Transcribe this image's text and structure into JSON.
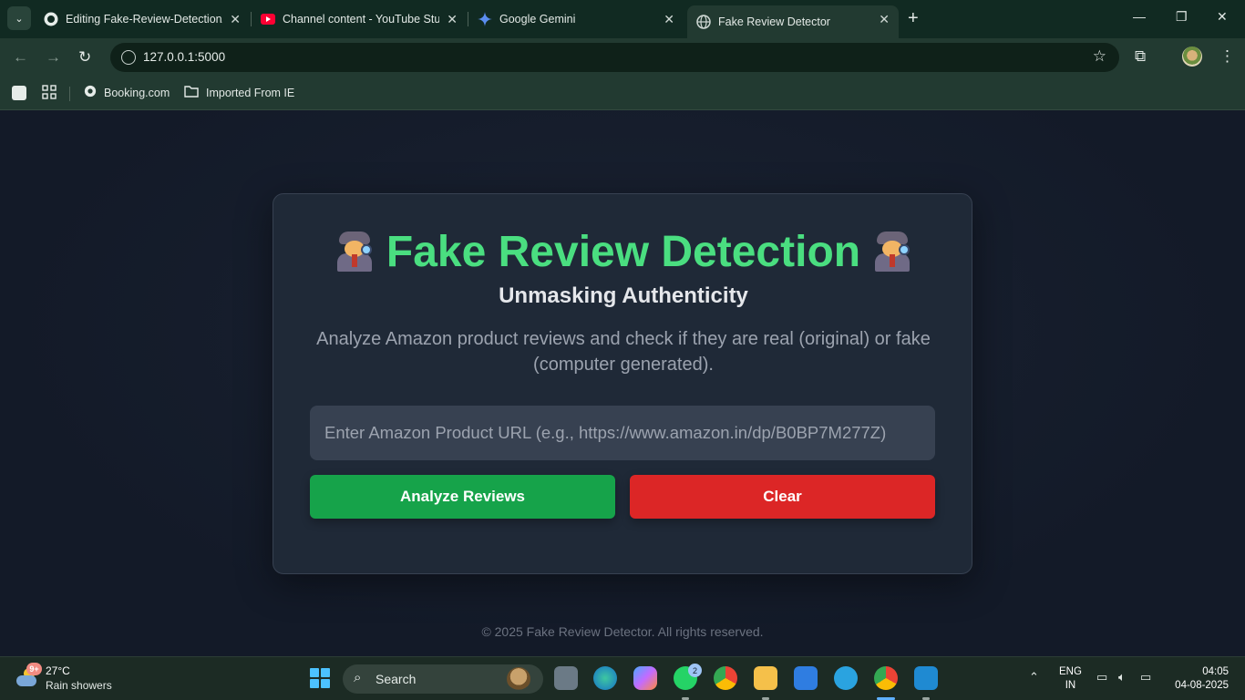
{
  "browser": {
    "tabs": [
      {
        "title": "Editing Fake-Review-Detection/",
        "icon": "github-icon"
      },
      {
        "title": "Channel content - YouTube Studio",
        "icon": "youtube-icon"
      },
      {
        "title": "Google Gemini",
        "icon": "gemini-icon"
      },
      {
        "title": "Fake Review Detector",
        "icon": "globe-icon",
        "active": true
      }
    ],
    "url": "127.0.0.1:5000",
    "bookmarks": [
      {
        "label": "Booking.com",
        "icon": "globe-icon"
      },
      {
        "label": "Imported From IE",
        "icon": "folder-icon"
      }
    ]
  },
  "page": {
    "title": "Fake Review Detection",
    "title_emoji": "detective-emoji",
    "subtitle": "Unmasking Authenticity",
    "description": "Analyze Amazon product reviews and check if they are real (original) or fake (computer generated).",
    "url_placeholder": "Enter Amazon Product URL (e.g., https://www.amazon.in/dp/B0BP7M277Z)",
    "analyze_label": "Analyze Reviews",
    "clear_label": "Clear",
    "footer": "© 2025 Fake Review Detector. All rights reserved.",
    "colors": {
      "title": "#4ade80",
      "analyze": "#16a34a",
      "clear": "#dc2626",
      "card": "#1f2937"
    }
  },
  "taskbar": {
    "weather_badge": "9+",
    "temperature": "27°C",
    "condition": "Rain showers",
    "search_label": "Search",
    "whatsapp_badge": "2",
    "lang_top": "ENG",
    "lang_bottom": "IN",
    "time": "04:05",
    "date": "04-08-2025"
  }
}
